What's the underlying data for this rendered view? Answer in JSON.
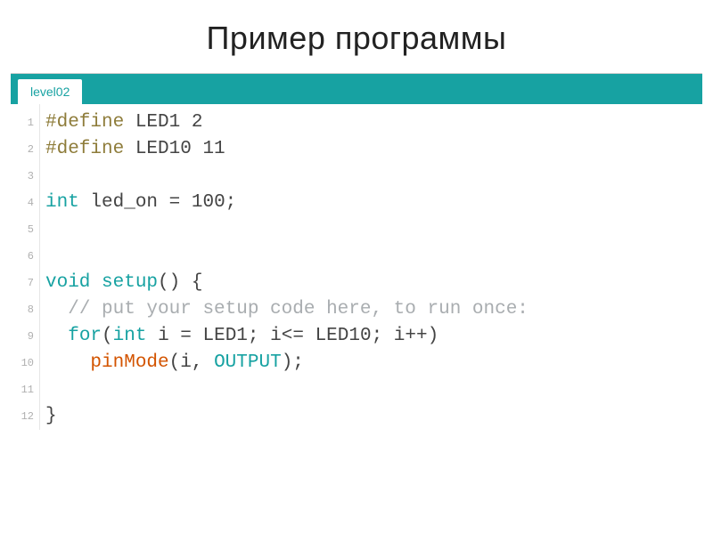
{
  "slide": {
    "title": "Пример программы"
  },
  "editor": {
    "tab_label": "level02",
    "code": {
      "lines": [
        {
          "num": "1",
          "tokens": [
            {
              "t": "#define ",
              "c": "macro"
            },
            {
              "t": "LED1 ",
              "c": "ident"
            },
            {
              "t": "2",
              "c": "num"
            }
          ]
        },
        {
          "num": "2",
          "tokens": [
            {
              "t": "#define ",
              "c": "macro"
            },
            {
              "t": "LED10 ",
              "c": "ident"
            },
            {
              "t": "11",
              "c": "num"
            }
          ]
        },
        {
          "num": "3",
          "tokens": []
        },
        {
          "num": "4",
          "tokens": [
            {
              "t": "int ",
              "c": "type"
            },
            {
              "t": "led_on ",
              "c": "ident"
            },
            {
              "t": "= ",
              "c": "punct"
            },
            {
              "t": "100",
              "c": "num"
            },
            {
              "t": ";",
              "c": "punct"
            }
          ]
        },
        {
          "num": "5",
          "tokens": []
        },
        {
          "num": "6",
          "tokens": []
        },
        {
          "num": "7",
          "tokens": [
            {
              "t": "void ",
              "c": "keyword"
            },
            {
              "t": "setup",
              "c": "struct"
            },
            {
              "t": "() {",
              "c": "punct"
            }
          ]
        },
        {
          "num": "8",
          "tokens": [
            {
              "t": "  ",
              "c": "plain"
            },
            {
              "t": "// put your setup code here, to run once:",
              "c": "comment"
            }
          ]
        },
        {
          "num": "9",
          "tokens": [
            {
              "t": "  ",
              "c": "plain"
            },
            {
              "t": "for",
              "c": "keyword"
            },
            {
              "t": "(",
              "c": "punct"
            },
            {
              "t": "int ",
              "c": "type"
            },
            {
              "t": "i ",
              "c": "ident"
            },
            {
              "t": "= ",
              "c": "punct"
            },
            {
              "t": "LED1",
              "c": "ident"
            },
            {
              "t": "; ",
              "c": "punct"
            },
            {
              "t": "i",
              "c": "ident"
            },
            {
              "t": "<= ",
              "c": "punct"
            },
            {
              "t": "LED10",
              "c": "ident"
            },
            {
              "t": "; ",
              "c": "punct"
            },
            {
              "t": "i",
              "c": "ident"
            },
            {
              "t": "++)",
              "c": "punct"
            }
          ]
        },
        {
          "num": "10",
          "tokens": [
            {
              "t": "    ",
              "c": "plain"
            },
            {
              "t": "pinMode",
              "c": "func"
            },
            {
              "t": "(",
              "c": "punct"
            },
            {
              "t": "i",
              "c": "ident"
            },
            {
              "t": ", ",
              "c": "punct"
            },
            {
              "t": "OUTPUT",
              "c": "builtin"
            },
            {
              "t": ");",
              "c": "punct"
            }
          ]
        },
        {
          "num": "11",
          "tokens": []
        },
        {
          "num": "12",
          "tokens": [
            {
              "t": "}",
              "c": "punct"
            }
          ]
        }
      ]
    }
  }
}
